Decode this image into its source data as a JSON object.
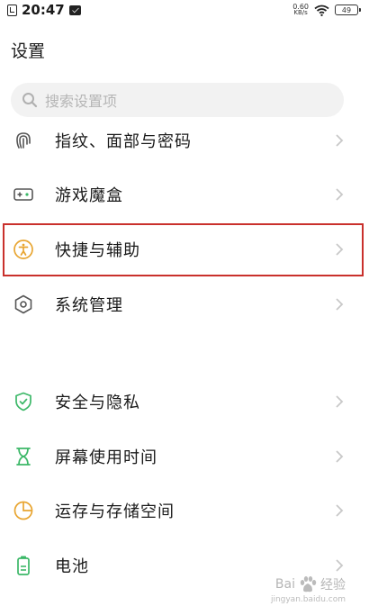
{
  "status_bar": {
    "time": "20:47",
    "net_speed_value": "0.60",
    "net_speed_unit": "KB/s",
    "battery": "49"
  },
  "header": {
    "title": "设置"
  },
  "search": {
    "placeholder": "搜索设置项"
  },
  "settings_items": [
    {
      "label": "指纹、面部与密码",
      "icon": "fingerprint-icon"
    },
    {
      "label": "游戏魔盒",
      "icon": "game-box-icon"
    },
    {
      "label": "快捷与辅助",
      "icon": "accessibility-icon",
      "highlighted": true
    },
    {
      "label": "系统管理",
      "icon": "system-management-icon"
    },
    {
      "label": "安全与隐私",
      "icon": "shield-icon"
    },
    {
      "label": "屏幕使用时间",
      "icon": "hourglass-icon"
    },
    {
      "label": "运存与存储空间",
      "icon": "pie-chart-icon"
    },
    {
      "label": "电池",
      "icon": "battery-icon"
    }
  ],
  "watermark": {
    "brand_left": "Bai",
    "brand_right": "经验",
    "url": "jingyan.baidu.com"
  },
  "colors": {
    "icon_gray": "#555555",
    "icon_green": "#3cb868",
    "icon_orange": "#e8a531",
    "highlight_red": "#c9302c",
    "chevron": "#c8c8c8"
  }
}
